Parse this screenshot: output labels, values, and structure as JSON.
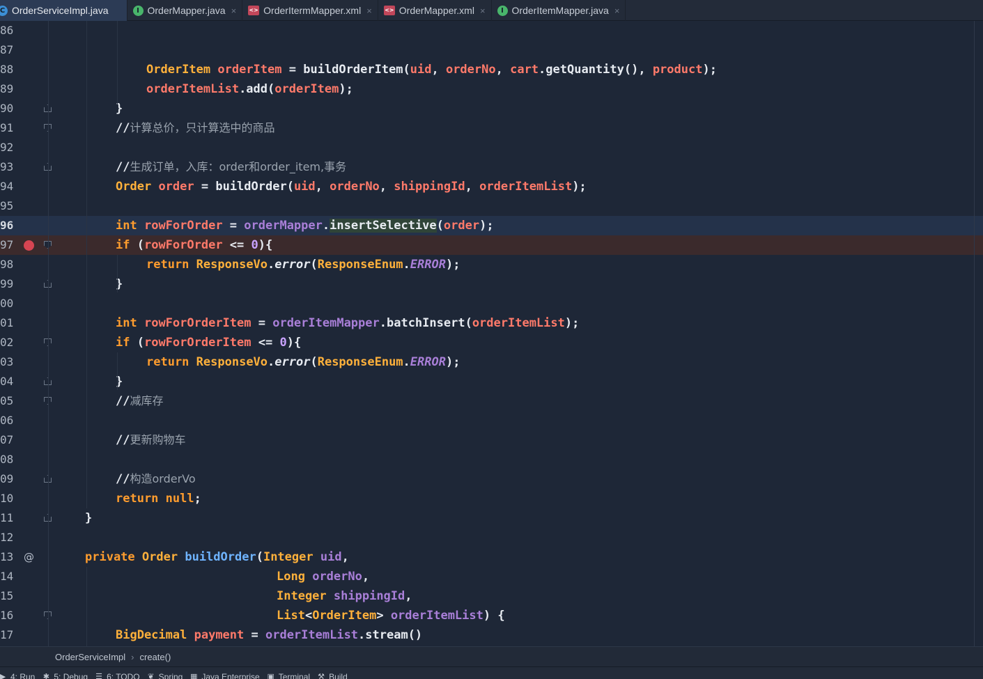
{
  "tabs": [
    {
      "label": "OrderServiceImpl.java",
      "icon": "class-icon",
      "badge": "C",
      "active": true,
      "closable": false
    },
    {
      "label": "OrderMapper.java",
      "icon": "interface-icon",
      "badge": "I",
      "active": false,
      "closable": true
    },
    {
      "label": "OrderItermMapper.xml",
      "icon": "xml-file-icon",
      "badge": "<>",
      "active": false,
      "closable": true
    },
    {
      "label": "OrderMapper.xml",
      "icon": "xml-file-icon",
      "badge": "<>",
      "active": false,
      "closable": true
    },
    {
      "label": "OrderItemMapper.java",
      "icon": "interface-icon",
      "badge": "I",
      "active": false,
      "closable": true
    }
  ],
  "close_glyph": "×",
  "editor": {
    "current_line": "96",
    "breakpoint_line": "97",
    "lines": [
      {
        "n": "86",
        "indent": 0,
        "fold": "",
        "tokens": []
      },
      {
        "n": "87",
        "indent": 0,
        "fold": "",
        "tokens": []
      },
      {
        "n": "88",
        "indent": 2,
        "fold": "",
        "tokens": [
          [
            "ty",
            "OrderItem"
          ],
          [
            "op",
            " "
          ],
          [
            "var",
            "orderItem"
          ],
          [
            "op",
            " = "
          ],
          [
            "fn",
            "buildOrderItem("
          ],
          [
            "var",
            "uid"
          ],
          [
            "op",
            ", "
          ],
          [
            "var",
            "orderNo"
          ],
          [
            "op",
            ", "
          ],
          [
            "var",
            "cart"
          ],
          [
            "op",
            ".getQuantity(), "
          ],
          [
            "var",
            "product"
          ],
          [
            "op",
            ");"
          ]
        ]
      },
      {
        "n": "89",
        "indent": 2,
        "fold": "",
        "tokens": [
          [
            "var",
            "orderItemList"
          ],
          [
            "op",
            ".add("
          ],
          [
            "var",
            "orderItem"
          ],
          [
            "op",
            ");"
          ]
        ]
      },
      {
        "n": "90",
        "indent": 1,
        "fold": "up",
        "tokens": [
          [
            "op",
            "}"
          ]
        ]
      },
      {
        "n": "91",
        "indent": 1,
        "fold": "dn",
        "tokens": [
          [
            "op",
            "//"
          ],
          [
            "cm",
            "计算总价，只计算选中的商品"
          ]
        ]
      },
      {
        "n": "92",
        "indent": 0,
        "fold": "",
        "tokens": []
      },
      {
        "n": "93",
        "indent": 1,
        "fold": "up",
        "tokens": [
          [
            "op",
            "//"
          ],
          [
            "cm",
            "生成订单，入库："
          ],
          [
            "cm",
            "order"
          ],
          [
            "cm",
            "和"
          ],
          [
            "cm",
            "order_item"
          ],
          [
            "cm",
            ","
          ],
          [
            "cm",
            "事务"
          ]
        ]
      },
      {
        "n": "94",
        "indent": 1,
        "fold": "",
        "tokens": [
          [
            "ty",
            "Order"
          ],
          [
            "op",
            " "
          ],
          [
            "var",
            "order"
          ],
          [
            "op",
            " = "
          ],
          [
            "fn",
            "buildOrder("
          ],
          [
            "var",
            "uid"
          ],
          [
            "op",
            ", "
          ],
          [
            "var",
            "orderNo"
          ],
          [
            "op",
            ", "
          ],
          [
            "var",
            "shippingId"
          ],
          [
            "op",
            ", "
          ],
          [
            "var",
            "orderItemList"
          ],
          [
            "op",
            ");"
          ]
        ]
      },
      {
        "n": "95",
        "indent": 0,
        "fold": "",
        "tokens": []
      },
      {
        "n": "96",
        "indent": 1,
        "fold": "",
        "tokens": [
          [
            "kw",
            "int"
          ],
          [
            "op",
            " "
          ],
          [
            "var",
            "rowForOrder"
          ],
          [
            "op",
            " = "
          ],
          [
            "fld",
            "orderMapper"
          ],
          [
            "op",
            "."
          ],
          [
            "hl",
            "insertSelective"
          ],
          [
            "op",
            "("
          ],
          [
            "var",
            "order"
          ],
          [
            "op",
            ");"
          ]
        ]
      },
      {
        "n": "97",
        "indent": 1,
        "fold": "dn",
        "tokens": [
          [
            "kw",
            "if"
          ],
          [
            "op",
            " ("
          ],
          [
            "var",
            "rowForOrder"
          ],
          [
            "op",
            " <= "
          ],
          [
            "num",
            "0"
          ],
          [
            "op",
            "){"
          ]
        ]
      },
      {
        "n": "98",
        "indent": 2,
        "fold": "",
        "tokens": [
          [
            "kw",
            "return"
          ],
          [
            "op",
            " "
          ],
          [
            "ty",
            "ResponseVo"
          ],
          [
            "op",
            "."
          ],
          [
            "fnI",
            "error"
          ],
          [
            "op",
            "("
          ],
          [
            "ty",
            "ResponseEnum"
          ],
          [
            "op",
            "."
          ],
          [
            "err",
            "ERROR"
          ],
          [
            "op",
            ");"
          ]
        ]
      },
      {
        "n": "99",
        "indent": 1,
        "fold": "up",
        "tokens": [
          [
            "op",
            "}"
          ]
        ]
      },
      {
        "n": "00",
        "indent": 0,
        "fold": "",
        "tokens": []
      },
      {
        "n": "01",
        "indent": 1,
        "fold": "",
        "tokens": [
          [
            "kw",
            "int"
          ],
          [
            "op",
            " "
          ],
          [
            "var",
            "rowForOrderItem"
          ],
          [
            "op",
            " = "
          ],
          [
            "fld",
            "orderItemMapper"
          ],
          [
            "op",
            ".batchInsert("
          ],
          [
            "var",
            "orderItemList"
          ],
          [
            "op",
            ");"
          ]
        ]
      },
      {
        "n": "02",
        "indent": 1,
        "fold": "dn",
        "tokens": [
          [
            "kw",
            "if"
          ],
          [
            "op",
            " ("
          ],
          [
            "var",
            "rowForOrderItem"
          ],
          [
            "op",
            " <= "
          ],
          [
            "num",
            "0"
          ],
          [
            "op",
            "){"
          ]
        ]
      },
      {
        "n": "03",
        "indent": 2,
        "fold": "",
        "tokens": [
          [
            "kw",
            "return"
          ],
          [
            "op",
            " "
          ],
          [
            "ty",
            "ResponseVo"
          ],
          [
            "op",
            "."
          ],
          [
            "fnI",
            "error"
          ],
          [
            "op",
            "("
          ],
          [
            "ty",
            "ResponseEnum"
          ],
          [
            "op",
            "."
          ],
          [
            "err",
            "ERROR"
          ],
          [
            "op",
            ");"
          ]
        ]
      },
      {
        "n": "04",
        "indent": 1,
        "fold": "up",
        "tokens": [
          [
            "op",
            "}"
          ]
        ]
      },
      {
        "n": "05",
        "indent": 1,
        "fold": "dn",
        "tokens": [
          [
            "op",
            "//"
          ],
          [
            "cm",
            "减库存"
          ]
        ]
      },
      {
        "n": "06",
        "indent": 0,
        "fold": "",
        "tokens": []
      },
      {
        "n": "07",
        "indent": 1,
        "fold": "",
        "tokens": [
          [
            "op",
            "//"
          ],
          [
            "cm",
            "更新购物车"
          ]
        ]
      },
      {
        "n": "08",
        "indent": 0,
        "fold": "",
        "tokens": []
      },
      {
        "n": "09",
        "indent": 1,
        "fold": "up",
        "tokens": [
          [
            "op",
            "//"
          ],
          [
            "cm",
            "构造"
          ],
          [
            "cmB",
            "orderVo"
          ]
        ]
      },
      {
        "n": "10",
        "indent": 1,
        "fold": "",
        "tokens": [
          [
            "kw",
            "return null"
          ],
          [
            "op",
            ";"
          ]
        ]
      },
      {
        "n": "11",
        "indent": 0,
        "fold": "up",
        "tokens": [
          [
            "op",
            "}"
          ]
        ]
      },
      {
        "n": "12",
        "indent": 0,
        "fold": "",
        "tokens": []
      },
      {
        "n": "13",
        "indent": 0,
        "fold": "",
        "at": "@",
        "tokens": [
          [
            "kw",
            "private"
          ],
          [
            "op",
            " "
          ],
          [
            "ty",
            "Order"
          ],
          [
            "op",
            " "
          ],
          [
            "dfn",
            "buildOrder"
          ],
          [
            "op",
            "("
          ],
          [
            "ty",
            "Integer"
          ],
          [
            "op",
            " "
          ],
          [
            "fld",
            "uid"
          ],
          [
            "op",
            ","
          ]
        ]
      },
      {
        "n": "14",
        "indent": 0,
        "pad": 275,
        "fold": "",
        "tokens": [
          [
            "ty",
            "Long"
          ],
          [
            "op",
            " "
          ],
          [
            "fld",
            "orderNo"
          ],
          [
            "op",
            ","
          ]
        ]
      },
      {
        "n": "15",
        "indent": 0,
        "pad": 275,
        "fold": "",
        "tokens": [
          [
            "ty",
            "Integer"
          ],
          [
            "op",
            " "
          ],
          [
            "fld",
            "shippingId"
          ],
          [
            "op",
            ","
          ]
        ]
      },
      {
        "n": "16",
        "indent": 0,
        "pad": 275,
        "fold": "dn",
        "tokens": [
          [
            "ty",
            "List"
          ],
          [
            "op",
            "<"
          ],
          [
            "ty",
            "OrderItem"
          ],
          [
            "op",
            "> "
          ],
          [
            "fld",
            "orderItemList"
          ],
          [
            "op",
            ") {"
          ]
        ]
      },
      {
        "n": "17",
        "indent": 1,
        "fold": "",
        "tokens": [
          [
            "ty",
            "BigDecimal"
          ],
          [
            "op",
            " "
          ],
          [
            "var",
            "payment"
          ],
          [
            "op",
            " = "
          ],
          [
            "fld",
            "orderItemList"
          ],
          [
            "op",
            ".stream()"
          ]
        ]
      }
    ]
  },
  "breadcrumb": {
    "class_name": "OrderServiceImpl",
    "separator": "›",
    "method": "create()"
  },
  "tool_windows": [
    {
      "label": "4: Run",
      "icon": "run-icon",
      "glyph": "▶"
    },
    {
      "label": "5: Debug",
      "icon": "debug-icon",
      "glyph": "✱"
    },
    {
      "label": "6: TODO",
      "icon": "todo-icon",
      "glyph": "☰"
    },
    {
      "label": "Spring",
      "icon": "spring-icon",
      "glyph": "❦"
    },
    {
      "label": "Java Enterprise",
      "icon": "java-enterprise-icon",
      "glyph": "▦"
    },
    {
      "label": "Terminal",
      "icon": "terminal-icon",
      "glyph": "▣"
    },
    {
      "label": "Build",
      "icon": "build-icon",
      "glyph": "⚒"
    }
  ]
}
